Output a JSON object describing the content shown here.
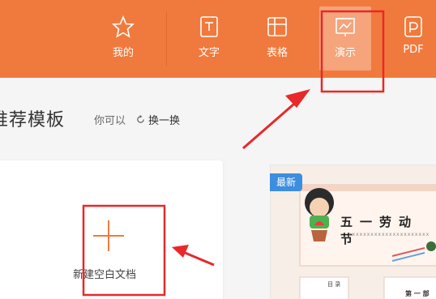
{
  "nav": {
    "items": [
      {
        "label": "我的",
        "icon": "star-icon"
      },
      {
        "label": "文字",
        "icon": "document-icon"
      },
      {
        "label": "表格",
        "icon": "table-icon"
      },
      {
        "label": "演示",
        "icon": "presentation-icon",
        "active": true
      },
      {
        "label": "PDF",
        "icon": "pdf-icon"
      }
    ]
  },
  "section": {
    "title": "推荐模板",
    "hint": "你可以",
    "refresh_label": "换一换"
  },
  "new_card": {
    "label": "新建空白文档",
    "icon": "plus-icon"
  },
  "template_card": {
    "badge": "最新",
    "title": "五一劳动节",
    "subtitle": "xxxxxxxxxxxxxxxxxxxxxx",
    "toc_label": "目 录",
    "part_label": "第 一 部"
  },
  "colors": {
    "topbar": "#f07a3d",
    "annotation_red": "#e8282b",
    "badge_blue": "#3d8de0",
    "plus_orange": "#f07a3d"
  }
}
